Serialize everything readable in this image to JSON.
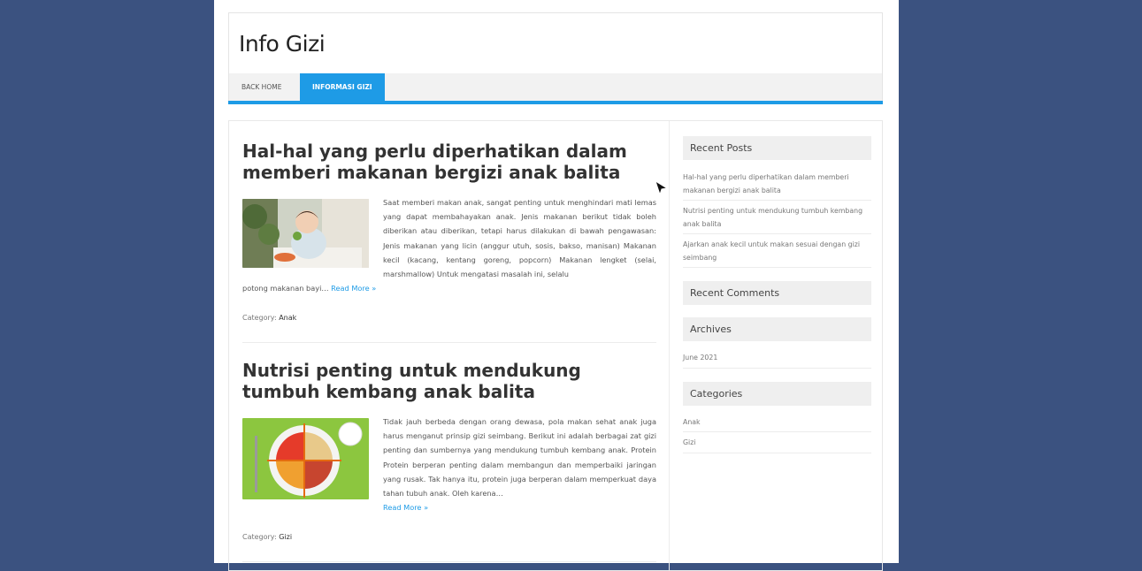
{
  "site": {
    "title": "Info Gizi"
  },
  "nav": [
    {
      "label": "BACK HOME"
    },
    {
      "label": "INFORMASI GIZI"
    }
  ],
  "colors": {
    "background": "#3b5280",
    "accent": "#1e9be6"
  },
  "posts": [
    {
      "title": "Hal-hal yang perlu diperhatikan dalam memberi makanan bergizi anak balita",
      "excerpt": "Saat memberi makan anak, sangat penting untuk menghindari mati lemas yang dapat membahayakan anak. Jenis makanan berikut tidak boleh diberikan atau diberikan, tetapi harus dilakukan di bawah pengawasan: Jenis makanan yang licin (anggur utuh, sosis, bakso, manisan) Makanan kecil (kacang, kentang goreng, popcorn) Makanan lengket (selai, marshmallow) Untuk mengatasi masalah ini, selalu",
      "excerpt_tail": "potong makanan bayi…",
      "read_more": "Read More »",
      "category_label": "Category:",
      "category": "Anak",
      "image_icon": "child-eating-photo"
    },
    {
      "title": "Nutrisi penting untuk mendukung tumbuh kembang anak balita",
      "excerpt": "Tidak jauh berbeda dengan orang dewasa, pola makan sehat anak juga harus menganut prinsip gizi seimbang. Berikut ini adalah berbagai zat gizi penting dan sumbernya yang mendukung tumbuh kembang anak. Protein Protein berperan penting dalam membangun dan memperbaiki jaringan yang rusak. Tak hanya itu, protein juga berperan dalam memperkuat daya tahan tubuh anak. Oleh karena…",
      "read_more": "Read More »",
      "category_label": "Category:",
      "category": "Gizi",
      "image_icon": "balanced-plate-photo"
    }
  ],
  "sidebar": {
    "recent_posts": {
      "title": "Recent Posts",
      "items": [
        "Hal-hal yang perlu diperhatikan dalam memberi makanan bergizi anak balita",
        "Nutrisi penting untuk mendukung tumbuh kembang anak balita",
        "Ajarkan anak kecil untuk makan sesuai dengan gizi seimbang"
      ]
    },
    "recent_comments": {
      "title": "Recent Comments"
    },
    "archives": {
      "title": "Archives",
      "items": [
        "June 2021"
      ]
    },
    "categories": {
      "title": "Categories",
      "items": [
        "Anak",
        "Gizi"
      ]
    }
  }
}
